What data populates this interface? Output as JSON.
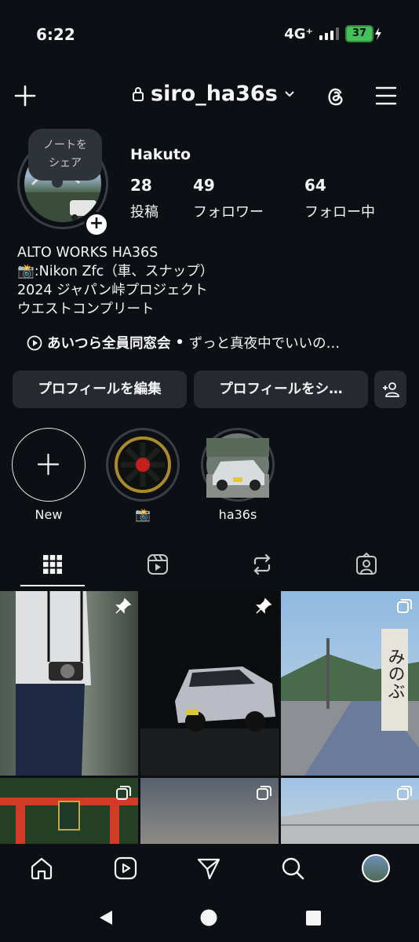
{
  "status_bar": {
    "time": "6:22",
    "network": "4G⁺",
    "battery": "37"
  },
  "header": {
    "username": "siro_ha36s",
    "icons": [
      "plus-icon",
      "lock-icon",
      "chevron-down-icon",
      "threads-icon",
      "menu-icon"
    ]
  },
  "profile": {
    "note": [
      "ノートを",
      "シェア"
    ],
    "display_name": "Hakuto",
    "stats": [
      {
        "count": "28",
        "label": "投稿"
      },
      {
        "count": "49",
        "label": "フォロワー"
      },
      {
        "count": "64",
        "label": "フォロー中"
      }
    ],
    "bio": [
      "ALTO WORKS HA36S",
      "📸:Nikon Zfc（車、スナップ）",
      "2024 ジャパン峠プロジェクト",
      "ウエストコンプリート"
    ],
    "music": {
      "title": "あいつら全員同窓会",
      "separator": "•",
      "song": "ずっと真夜中でいいの…"
    }
  },
  "actions": {
    "edit": "プロフィールを編集",
    "share": "プロフィールをシ…"
  },
  "highlights": [
    {
      "label": "New"
    },
    {
      "label": "📸"
    },
    {
      "label": "ha36s"
    }
  ],
  "tabs": [
    "grid-icon",
    "reels-icon",
    "reposts-icon",
    "tagged-icon"
  ],
  "bottom_nav": [
    "home-icon",
    "reels-icon",
    "send-icon",
    "search-icon",
    "profile-avatar"
  ],
  "colors": {
    "background": "#0c0f14",
    "button": "#262a30",
    "text": "#f5f5f5",
    "battery": "#45c05a"
  }
}
